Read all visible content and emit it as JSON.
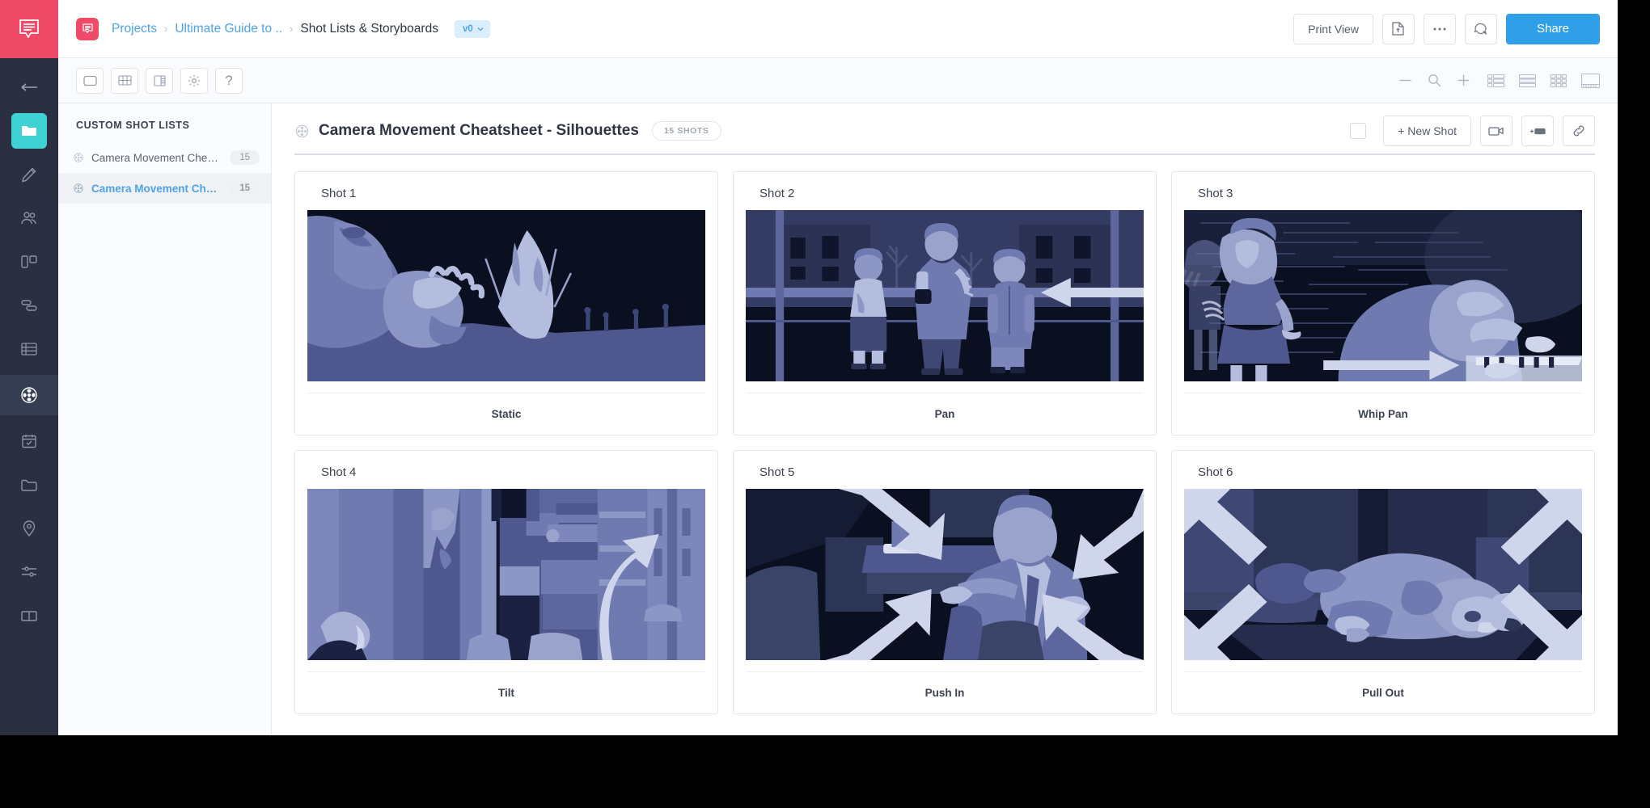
{
  "app": {
    "logo_icon": "studiobinder-speech-bubble-logo"
  },
  "rail": {
    "items": [
      {
        "name": "back-arrow",
        "icon": "arrow-left-icon"
      },
      {
        "name": "projects",
        "icon": "folder-icon",
        "state": "teal"
      },
      {
        "name": "write",
        "icon": "pencil-icon"
      },
      {
        "name": "contacts",
        "icon": "people-icon"
      },
      {
        "name": "boards",
        "icon": "columns-icon"
      },
      {
        "name": "workflow",
        "icon": "stack-icon"
      },
      {
        "name": "breakdown",
        "icon": "table-rows-icon"
      },
      {
        "name": "shot-lists",
        "icon": "film-reel-icon",
        "state": "active"
      },
      {
        "name": "calendar",
        "icon": "calendar-check-icon"
      },
      {
        "name": "files",
        "icon": "folder-outline-icon"
      },
      {
        "name": "locations",
        "icon": "map-pin-icon"
      },
      {
        "name": "settings-sliders",
        "icon": "sliders-icon"
      },
      {
        "name": "reports",
        "icon": "book-icon"
      }
    ]
  },
  "topbar": {
    "breadcrumb": [
      {
        "label": "Projects",
        "type": "link"
      },
      {
        "label": "Ultimate Guide to ..",
        "type": "link"
      },
      {
        "label": "Shot Lists & Storyboards",
        "type": "current"
      }
    ],
    "separator": "›",
    "version_badge": "v0",
    "version_caret": "chevron-down-icon",
    "print_view_label": "Print View",
    "export_icon": "file-export-icon",
    "more_icon": "ellipsis-icon",
    "comments_icon": "comment-bubble-icon",
    "share_label": "Share",
    "share_color": "#2f9fe8"
  },
  "toolbar": {
    "left_buttons": [
      {
        "name": "storyboard-view-button",
        "icon": "rounded-rect-icon"
      },
      {
        "name": "grid-view-button",
        "icon": "grid-cells-icon"
      },
      {
        "name": "column-view-button",
        "icon": "side-panel-icon"
      },
      {
        "name": "settings-button",
        "icon": "gear-icon"
      },
      {
        "name": "help-button",
        "icon": "question-mark-icon",
        "glyph": "?"
      }
    ],
    "zoom_out_icon": "minus-icon",
    "zoom_reset_icon": "magnifier-icon",
    "zoom_in_icon": "plus-icon",
    "layout_buttons": [
      {
        "name": "layout-list-thumb-button",
        "icon": "list-thumb-icon"
      },
      {
        "name": "layout-rows-button",
        "icon": "rows-icon"
      },
      {
        "name": "layout-grid-button",
        "icon": "nine-grid-icon"
      },
      {
        "name": "layout-filmstrip-button",
        "icon": "filmstrip-icon"
      }
    ]
  },
  "sidebar": {
    "title": "CUSTOM SHOT LISTS",
    "items": [
      {
        "label": "Camera Movement Cheatsheet",
        "count": "15",
        "icon": "film-reel-icon",
        "active": false
      },
      {
        "label": "Camera Movement Cheatsheet - S...",
        "count": "15",
        "icon": "film-reel-icon",
        "active": true
      }
    ]
  },
  "main": {
    "reel_icon": "film-reel-icon",
    "title": "Camera Movement Cheatsheet - Silhouettes",
    "shots_badge": "15 SHOTS",
    "select_all_checkbox": "unchecked",
    "new_shot_label": "+ New Shot",
    "camera_icon": "video-camera-icon",
    "add_row_icon": "add-row-icon",
    "link_icon": "chain-link-icon",
    "shots": [
      {
        "number": "Shot 1",
        "movement": "Static",
        "scene": "soldier-explosion"
      },
      {
        "number": "Shot 2",
        "movement": "Pan",
        "scene": "three-figures-street"
      },
      {
        "number": "Shot 3",
        "movement": "Whip Pan",
        "scene": "girl-and-piano-motionblur"
      },
      {
        "number": "Shot 4",
        "movement": "Tilt",
        "scene": "city-street-lookup"
      },
      {
        "number": "Shot 5",
        "movement": "Push In",
        "scene": "seated-man-office"
      },
      {
        "number": "Shot 6",
        "movement": "Pull Out",
        "scene": "figure-lying-down"
      }
    ]
  },
  "colors": {
    "brand_pink": "#ef4a68",
    "accent_blue": "#2f9fe8",
    "link_blue": "#4ea3e8",
    "rail_dark": "#2a3040",
    "teal": "#3fd0d4",
    "thumb_dark": "#0b1020",
    "thumb_mid": "#6f7ab0",
    "thumb_light": "#b4bddd",
    "arrow_light": "#cfd6ec"
  }
}
